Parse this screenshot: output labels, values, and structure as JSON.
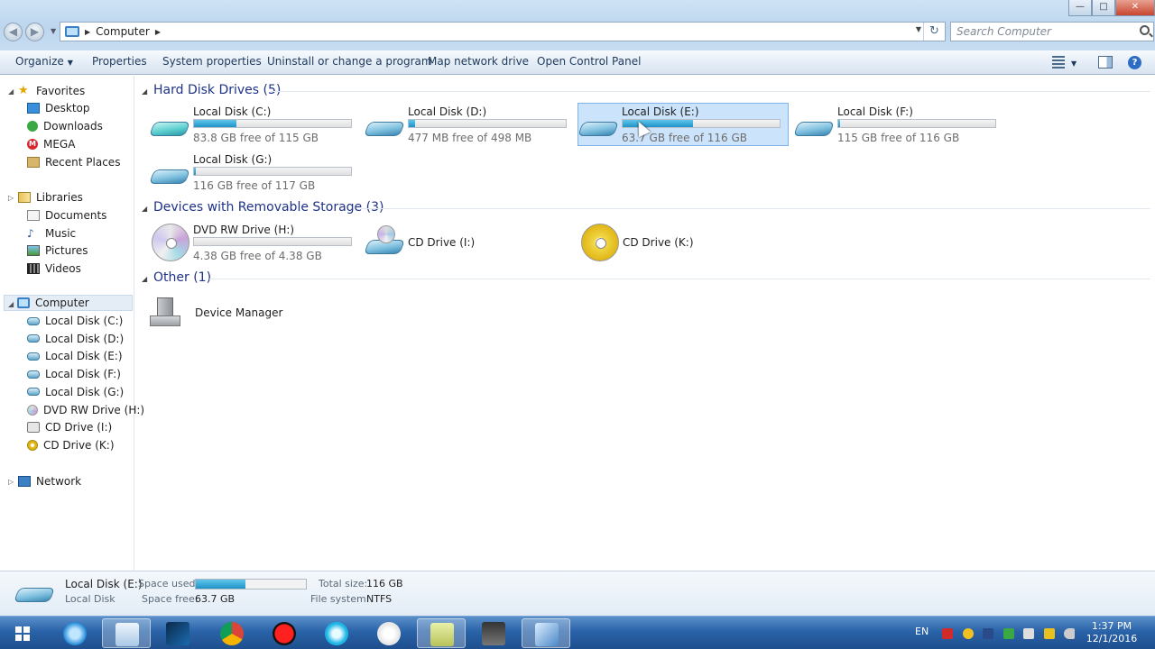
{
  "window": {
    "breadcrumb": "Computer",
    "search_placeholder": "Search Computer",
    "buttons": {
      "minimize": "—",
      "maximize": "□",
      "close": "✕"
    }
  },
  "commands": {
    "organize": "Organize",
    "properties": "Properties",
    "system_properties": "System properties",
    "uninstall": "Uninstall or change a program",
    "map_drive": "Map network drive",
    "control_panel": "Open Control Panel"
  },
  "nav": {
    "favorites": "Favorites",
    "desktop": "Desktop",
    "downloads": "Downloads",
    "mega": "MEGA",
    "recent": "Recent Places",
    "libraries": "Libraries",
    "documents": "Documents",
    "music": "Music",
    "pictures": "Pictures",
    "videos": "Videos",
    "computer": "Computer",
    "drives": [
      "Local Disk (C:)",
      "Local Disk (D:)",
      "Local Disk (E:)",
      "Local Disk (F:)",
      "Local Disk (G:)",
      "DVD RW Drive (H:)",
      "CD Drive (I:)",
      "CD Drive (K:)"
    ],
    "network": "Network"
  },
  "groups": {
    "hdd": "Hard Disk Drives (5)",
    "removable": "Devices with Removable Storage (3)",
    "other": "Other (1)"
  },
  "hdd": [
    {
      "name": "Local Disk (C:)",
      "free": "83.8 GB free of 115 GB",
      "used_fraction": 0.27
    },
    {
      "name": "Local Disk (D:)",
      "free": "477 MB free of 498 MB",
      "used_fraction": 0.04
    },
    {
      "name": "Local Disk (E:)",
      "free": "63.7 GB free of 116 GB",
      "used_fraction": 0.45
    },
    {
      "name": "Local Disk (F:)",
      "free": "115 GB free of 116 GB",
      "used_fraction": 0.01
    },
    {
      "name": "Local Disk (G:)",
      "free": "116 GB free of 117 GB",
      "used_fraction": 0.01
    }
  ],
  "removable": [
    {
      "name": "DVD RW Drive (H:)",
      "free": "4.38 GB free of 4.38 GB",
      "used_fraction": 0.0
    },
    {
      "name": "CD Drive (I:)"
    },
    {
      "name": "CD Drive (K:)"
    }
  ],
  "other": [
    {
      "name": "Device Manager"
    }
  ],
  "details": {
    "name": "Local Disk (E:)",
    "type": "Local Disk",
    "space_used_label": "Space used:",
    "space_free_label": "Space free:",
    "space_free": "63.7 GB",
    "total_label": "Total size:",
    "total": "116 GB",
    "fs_label": "File system:",
    "fs": "NTFS",
    "used_fraction": 0.45
  },
  "taskbar": {
    "lang": "EN",
    "time": "1:37 PM",
    "date": "12/1/2016"
  },
  "colors": {
    "accent": "#1e3287",
    "bar_fill": "#1f92c8",
    "selection": "#cce4fb"
  }
}
